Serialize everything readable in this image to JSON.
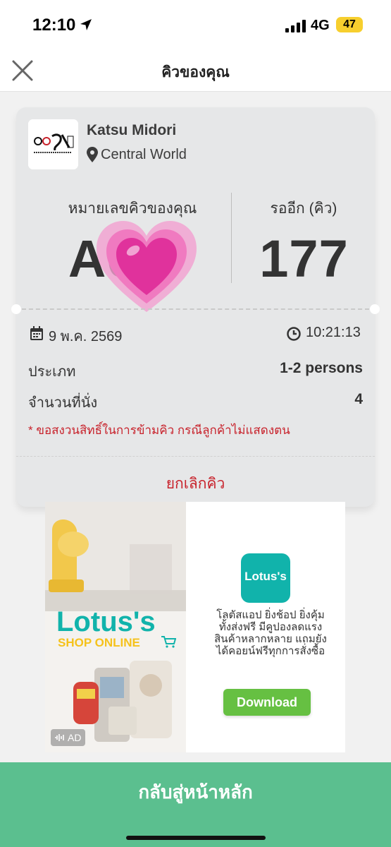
{
  "status_bar": {
    "time": "12:10",
    "network": "4G",
    "battery": "47"
  },
  "header": {
    "title": "คิวของคุณ",
    "close_icon": "close-icon"
  },
  "shop": {
    "name": "Katsu Midori",
    "branch": "Central World",
    "logo_text": "KATSU MIDORI"
  },
  "queue": {
    "label": "หมายเลขคิวของคุณ",
    "number": "A0  7",
    "waiting_label": "รออีก (คิว)",
    "waiting_count": "177",
    "overlay_emoji": "growing-heart"
  },
  "details": {
    "date": "9 พ.ค. 2569",
    "time": "10:21:13",
    "type_label": "ประเภท",
    "type_value": "1-2 persons",
    "seats_label": "จำนวนที่นั่ง",
    "seats_value": "4",
    "note": "* ขอสงวนสิทธิ์ในการข้ามคิว กรณีลูกค้าไม่แสดงตน",
    "cancel_label": "ยกเลิกคิว"
  },
  "ad": {
    "badge": "AD",
    "brand": "Lotus's",
    "image_title": "Lotus's",
    "image_subtitle": "SHOP ONLINE",
    "description_lines": [
      "โลตัสแอป ยิ่งช้อป ยิ่งคุ้ม",
      "ทั้งส่งฟรี มีคูปองลดแรง",
      "สินค้าหลากหลาย แถมยัง",
      "ได้คอยน์ฟรีทุกการสั่งซื้อ"
    ],
    "download_label": "Download",
    "colors": {
      "brand_teal": "#11b3ab",
      "download_green": "#66c042",
      "brand_yellow": "#f5c21c"
    }
  },
  "bottom_button": {
    "label": "กลับสู่หน้าหลัก"
  },
  "colors": {
    "primary_green": "#5bbf8f",
    "danger_red": "#c8232c",
    "card_bg": "#e6e7e8"
  }
}
